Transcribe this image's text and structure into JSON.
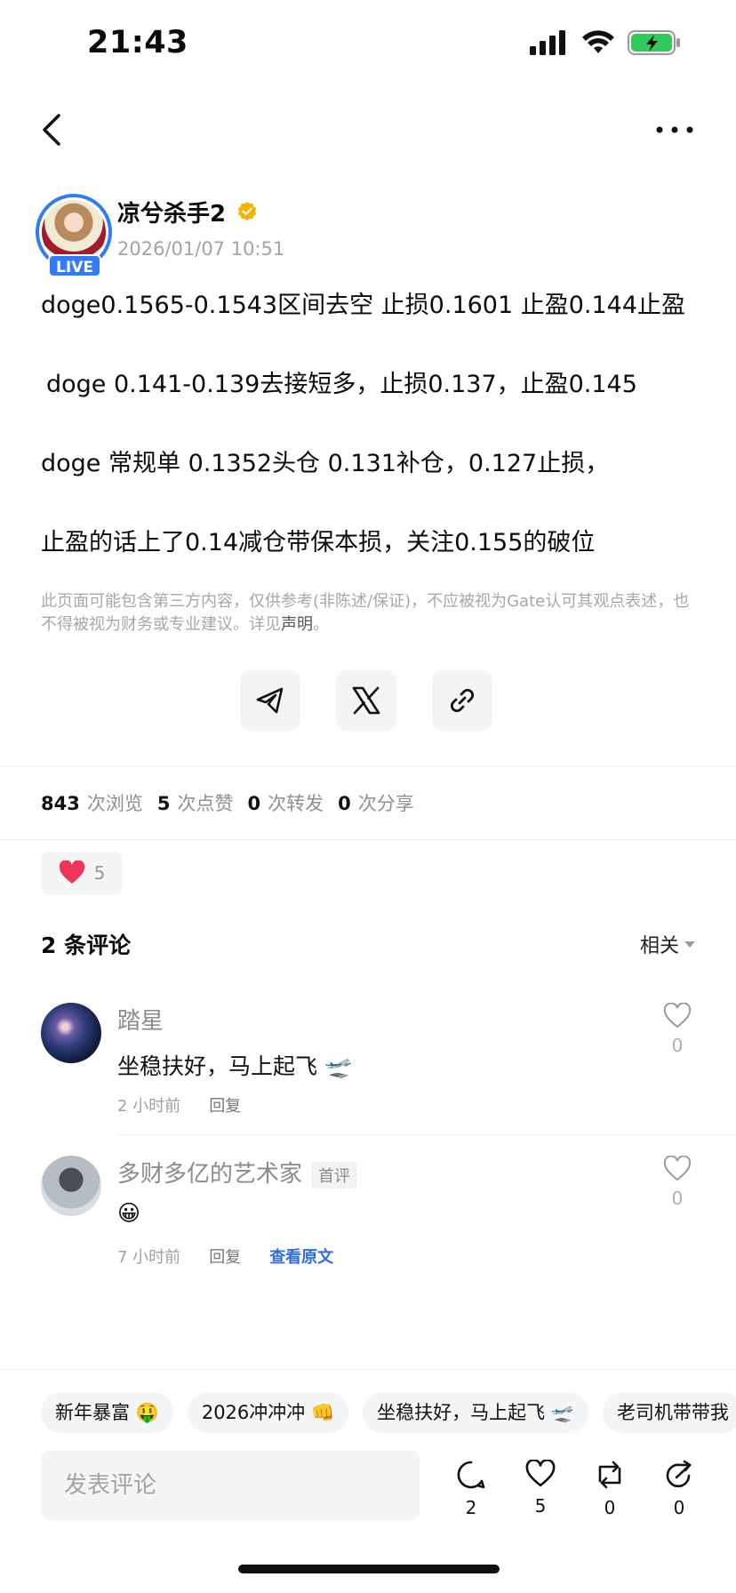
{
  "status_bar": {
    "time": "21:43"
  },
  "author": {
    "name": "凉兮杀手2",
    "timestamp": "2026/01/07 10:51",
    "live_badge": "LIVE"
  },
  "post": {
    "lines": [
      "doge0.1565-0.1543区间去空 止损0.1601 止盈0.144止盈",
      "doge 0.141-0.139去接短多，止损0.137，止盈0.145",
      "doge 常规单 0.1352头仓 0.131补仓，0.127止损，",
      "止盈的话上了0.14减仓带保本损，关注0.155的破位"
    ],
    "disclaimer": "此页面可能包含第三方内容，仅供参考(非陈述/保证)，不应被视为Gate认可其观点表述，也不得被视为财务或专业建议。详见",
    "disclaimer_link": "声明",
    "disclaimer_end": "。"
  },
  "stats": {
    "views": "843",
    "views_label": "次浏览",
    "likes": "5",
    "likes_label": "次点赞",
    "reposts": "0",
    "reposts_label": "次转发",
    "shares": "0",
    "shares_label": "次分享"
  },
  "reaction": {
    "count": "5"
  },
  "comments_section": {
    "title": "2 条评论",
    "sort_label": "相关",
    "items": [
      {
        "name": "踏星",
        "text": "坐稳扶好，马上起飞 🛫",
        "time": "2 小时前",
        "reply": "回复",
        "likes": "0"
      },
      {
        "name": "多财多亿的艺术家",
        "badge": "首评",
        "text": "😀",
        "time": "7 小时前",
        "reply": "回复",
        "view_original": "查看原文",
        "likes": "0"
      }
    ]
  },
  "quick_replies": [
    "新年暴富 🤑",
    "2026冲冲冲 👊",
    "坐稳扶好，马上起飞 🛫",
    "老司机带带我"
  ],
  "bottom_bar": {
    "input_placeholder": "发表评论",
    "comment_count": "2",
    "like_count": "5",
    "repost_count": "0",
    "share_count": "0"
  },
  "colors": {
    "accent": "#2f7cf6",
    "heart": "#f0355a",
    "link": "#2f6dde",
    "verified": "#f5b300"
  }
}
